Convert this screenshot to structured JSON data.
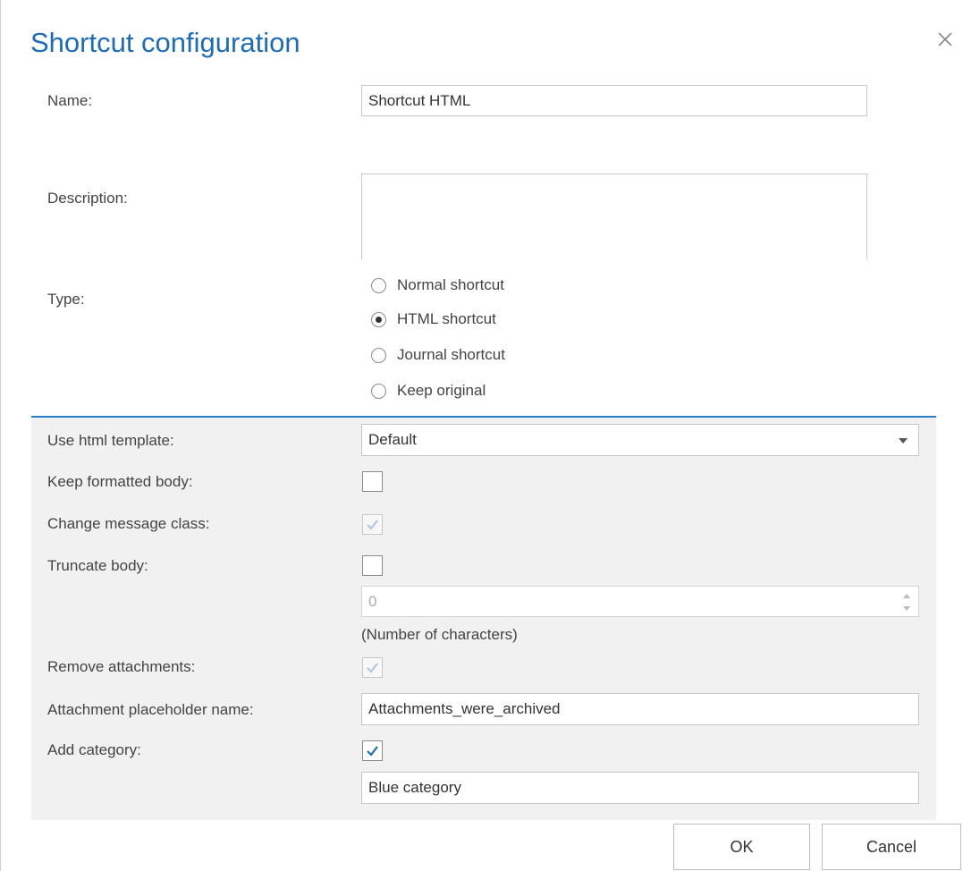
{
  "dialog": {
    "title": "Shortcut configuration"
  },
  "fields": {
    "name_label": "Name:",
    "name_value": "Shortcut HTML",
    "description_label": "Description:",
    "description_value": "",
    "type_label": "Type:",
    "type_options": [
      "Normal shortcut",
      "HTML shortcut",
      "Journal shortcut",
      "Keep original"
    ],
    "type_selected": "HTML shortcut"
  },
  "advanced": {
    "html_template_label": "Use html template:",
    "html_template_value": "Default",
    "keep_formatted_label": "Keep formatted body:",
    "keep_formatted_checked": false,
    "change_class_label": "Change message class:",
    "change_class_checked": true,
    "truncate_label": "Truncate body:",
    "truncate_checked": false,
    "truncate_value": "0",
    "truncate_hint": "(Number of characters)",
    "remove_attach_label": "Remove attachments:",
    "remove_attach_checked": true,
    "placeholder_label": "Attachment placeholder name:",
    "placeholder_value": "Attachments_were_archived",
    "category_label": "Add category:",
    "category_checked": true,
    "category_value": "Blue category"
  },
  "buttons": {
    "ok": "OK",
    "cancel": "Cancel"
  },
  "colors": {
    "accent": "#1e6cb8",
    "panel": "#f1f1f1",
    "divider": "#2a7dc9"
  }
}
